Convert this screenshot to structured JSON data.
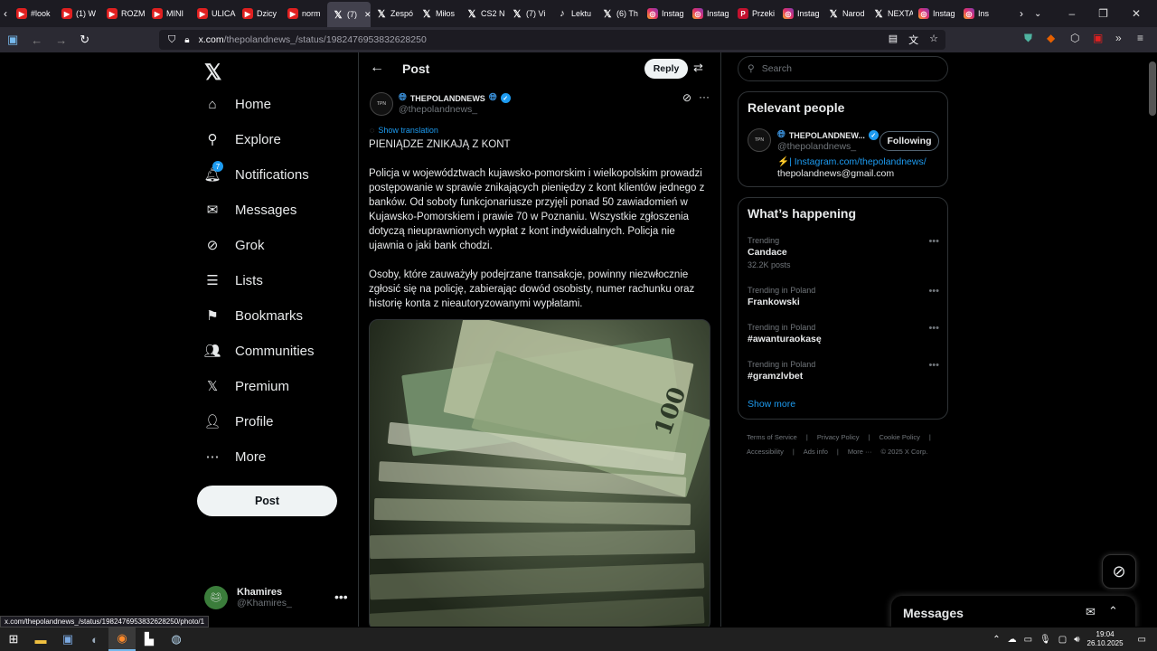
{
  "browser": {
    "tabs": [
      {
        "icon": "yt",
        "label": "#look"
      },
      {
        "icon": "yt",
        "label": "(1) W"
      },
      {
        "icon": "yt",
        "label": "ROZM"
      },
      {
        "icon": "yt",
        "label": "MINI"
      },
      {
        "icon": "yt",
        "label": "ULICA"
      },
      {
        "icon": "yt",
        "label": "Dzicy"
      },
      {
        "icon": "yt",
        "label": "norm"
      },
      {
        "icon": "x",
        "label": "(7)",
        "active": true
      },
      {
        "icon": "x",
        "label": "Zespó"
      },
      {
        "icon": "x",
        "label": "Miłos"
      },
      {
        "icon": "x",
        "label": "CS2 N"
      },
      {
        "icon": "x",
        "label": "(7) Vi"
      },
      {
        "icon": "tt",
        "label": "Lektu"
      },
      {
        "icon": "x",
        "label": "(6) Th"
      },
      {
        "icon": "ig",
        "label": "Instag"
      },
      {
        "icon": "ig",
        "label": "Instag"
      },
      {
        "icon": "pr",
        "label": "Przeki"
      },
      {
        "icon": "ig",
        "label": "Instag"
      },
      {
        "icon": "x",
        "label": "Narod"
      },
      {
        "icon": "x",
        "label": "NEXTA"
      },
      {
        "icon": "ig",
        "label": "Instag"
      },
      {
        "icon": "ig",
        "label": "Ins"
      }
    ],
    "url_domain": "x.com",
    "url_path": "/thepolandnews_/status/1982476953832628250",
    "status_url": "x.com/thepolandnews_/status/1982476953832628250/photo/1"
  },
  "leftnav": {
    "items": [
      {
        "key": "home",
        "label": "Home",
        "icon": "⌂"
      },
      {
        "key": "explore",
        "label": "Explore",
        "icon": "⚲"
      },
      {
        "key": "notifications",
        "label": "Notifications",
        "icon": "🔔︎",
        "badge": "7"
      },
      {
        "key": "messages",
        "label": "Messages",
        "icon": "✉"
      },
      {
        "key": "grok",
        "label": "Grok",
        "icon": "⊘"
      },
      {
        "key": "lists",
        "label": "Lists",
        "icon": "☰"
      },
      {
        "key": "bookmarks",
        "label": "Bookmarks",
        "icon": "⚑"
      },
      {
        "key": "communities",
        "label": "Communities",
        "icon": "👥︎"
      },
      {
        "key": "premium",
        "label": "Premium",
        "icon": "𝕏"
      },
      {
        "key": "profile",
        "label": "Profile",
        "icon": "👤︎"
      },
      {
        "key": "more",
        "label": "More",
        "icon": "⋯"
      }
    ],
    "post_button": "Post",
    "account": {
      "name": "Khamires",
      "handle": "@Khamires_"
    }
  },
  "main": {
    "title": "Post",
    "reply_button": "Reply",
    "post": {
      "avatar_text": "TPN",
      "author": "THEPOLANDNEWS",
      "handle": "@thepolandnews_",
      "show_translation": "Show translation",
      "headline": "PIENIĄDZE ZNIKAJĄ Z KONT",
      "paragraph1": "Policja w województwach kujawsko-pomorskim i wielkopolskim prowadzi postępowanie w sprawie znikających pieniędzy z kont klientów jednego z banków. Od soboty funkcjonariusze przyjęli ponad 50 zawiadomień w Kujawsko-Pomorskiem i prawie 70 w Poznaniu. Wszystkie zgłoszenia dotyczą nieuprawnionych wypłat z kont indywidualnych. Policja nie ujawnia o jaki bank chodzi.",
      "paragraph2": "Osoby, które zauważyły podejrzane transakcje, powinny niezwłocznie zgłosić się na policję, zabierając dowód osobisty, numer rachunku oraz historię konta z nieautoryzowanymi wypłatami.",
      "photo_label": "100"
    }
  },
  "right": {
    "search_placeholder": "Search",
    "relevant_people": {
      "heading": "Relevant people",
      "name": "THEPOLANDNEW...",
      "handle": "@thepolandnews_",
      "follow_label": "Following",
      "bio_link": "| Instagram.com/thepolandnews/",
      "bio_email": "thepolandnews@gmail.com"
    },
    "happening": {
      "heading": "What’s happening",
      "trends": [
        {
          "context": "Trending",
          "name": "Candace",
          "count": "32.2K posts"
        },
        {
          "context": "Trending in Poland",
          "name": "Frankowski",
          "count": ""
        },
        {
          "context": "Trending in Poland",
          "name": "#awanturaokasę",
          "count": ""
        },
        {
          "context": "Trending in Poland",
          "name": "#gramzlvbet",
          "count": ""
        }
      ],
      "show_more": "Show more"
    },
    "footer": {
      "row1": [
        "Terms of Service",
        "|",
        "Privacy Policy",
        "|",
        "Cookie Policy",
        "|"
      ],
      "row2": [
        "Accessibility",
        "|",
        "Ads info",
        "|",
        "More ···",
        "© 2025 X Corp."
      ]
    }
  },
  "messages_drawer": {
    "title": "Messages"
  },
  "taskbar": {
    "time": "19:04",
    "date": "26.10.2025"
  }
}
